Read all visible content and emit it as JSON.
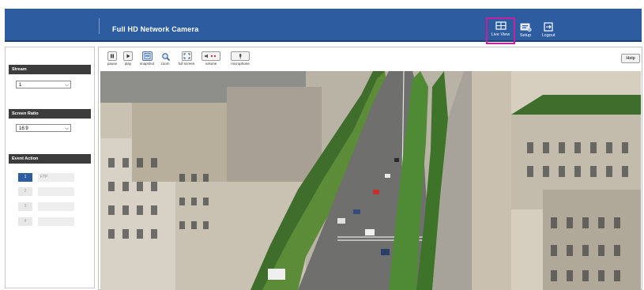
{
  "header": {
    "title": "Full HD Network Camera",
    "nav": [
      {
        "label": "Live View"
      },
      {
        "label": "Setup"
      },
      {
        "label": "Logout"
      }
    ]
  },
  "left_panel": {
    "stream": {
      "title": "Stream",
      "value": "1"
    },
    "screen_ratio": {
      "title": "Screen Ratio",
      "value": "16:9"
    },
    "event_action": {
      "title": "Event Action",
      "rows": [
        {
          "num": "1",
          "field": "FTP"
        },
        {
          "num": "2",
          "field": ""
        },
        {
          "num": "3",
          "field": ""
        },
        {
          "num": "4",
          "field": ""
        }
      ]
    }
  },
  "toolbar": {
    "buttons": [
      {
        "label": "pause",
        "icon": "pause-icon"
      },
      {
        "label": "play",
        "icon": "play-icon"
      },
      {
        "label": "snapshot",
        "icon": "snapshot-icon"
      },
      {
        "label": "zoom",
        "icon": "zoom-icon"
      },
      {
        "label": "full screen",
        "icon": "fullscreen-icon"
      },
      {
        "label": "volume",
        "icon": "volume-icon"
      },
      {
        "label": "microphone",
        "icon": "microphone-icon"
      }
    ],
    "help": "Help"
  },
  "colors": {
    "header_bg": "#2d5ca0",
    "highlight": "#c81fa0",
    "section_bg": "#3c3c3c"
  }
}
